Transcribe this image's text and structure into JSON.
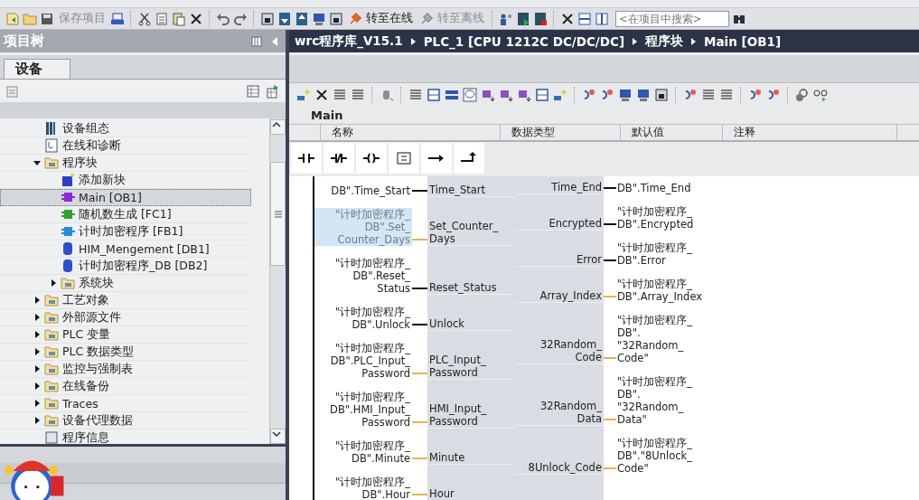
{
  "toolbar": {
    "items": [
      {
        "kind": "save",
        "label": "保存项目",
        "disabled": true
      },
      {
        "kind": "online",
        "label": "转至在线",
        "disabled": false
      },
      {
        "kind": "offline",
        "label": "转至离线",
        "disabled": true
      }
    ],
    "search": {
      "placeholder": "<在项目中搜索>"
    }
  },
  "project_tree": {
    "title": "项目树",
    "tabs": [
      {
        "label": "设备",
        "selected": true
      }
    ],
    "items": [
      {
        "label": "设备组态",
        "kind": "device",
        "selected": false
      },
      {
        "label": "在线和诊断",
        "kind": "diag",
        "selected": false
      },
      {
        "label": "程序块",
        "kind": "folder",
        "selected": false,
        "expanded": true,
        "children": [
          {
            "label": "添加新块",
            "kind": "add",
            "selected": false
          },
          {
            "label": "Main [OB1]",
            "kind": "ob",
            "selected": true
          },
          {
            "label": "随机数生成 [FC1]",
            "kind": "fc",
            "selected": false
          },
          {
            "label": "计时加密程序 [FB1]",
            "kind": "fb",
            "selected": false
          },
          {
            "label": "HIM_Mengement [DB1]",
            "kind": "db",
            "selected": false
          },
          {
            "label": "计时加密程序_DB [DB2]",
            "kind": "db",
            "selected": false
          },
          {
            "label": "系统块",
            "kind": "folder",
            "selected": false,
            "expanded": false
          }
        ]
      },
      {
        "label": "工艺对象",
        "kind": "folder",
        "selected": false,
        "expanded": false
      },
      {
        "label": "外部源文件",
        "kind": "folder",
        "selected": false,
        "expanded": false
      },
      {
        "label": "PLC 变量",
        "kind": "folder",
        "selected": false,
        "expanded": false
      },
      {
        "label": "PLC 数据类型",
        "kind": "folder",
        "selected": false,
        "expanded": false
      },
      {
        "label": "监控与强制表",
        "kind": "folder",
        "selected": false,
        "expanded": false
      },
      {
        "label": "在线备份",
        "kind": "folder",
        "selected": false,
        "expanded": false
      },
      {
        "label": "Traces",
        "kind": "folder",
        "selected": false,
        "expanded": false
      },
      {
        "label": "设备代理数据",
        "kind": "folder",
        "selected": false,
        "expanded": false
      },
      {
        "label": "程序信息",
        "kind": "info",
        "selected": false
      }
    ]
  },
  "editor": {
    "breadcrumb": [
      "wrc程序库_V15.1",
      "PLC_1 [CPU 1212C DC/DC/DC]",
      "程序块",
      "Main [OB1]"
    ],
    "block_title": "Main",
    "interface_columns": [
      "名称",
      "数据类型",
      "默认值",
      "注释"
    ],
    "block": {
      "inputs": [
        {
          "operand": "DB\".Time_Start",
          "pin": "Time_Start",
          "kind": "bool",
          "selected": false
        },
        {
          "operand": "\"计时加密程序_\nDB\".Set_\nCounter_Days",
          "pin": "Set_Counter_\nDays",
          "kind": "word",
          "selected": true
        },
        {
          "operand": "\"计时加密程序_\nDB\".Reset_\nStatus",
          "pin": "Reset_Status",
          "kind": "bool",
          "selected": false
        },
        {
          "operand": "\"计时加密程序_\nDB\".Unlock",
          "pin": "Unlock",
          "kind": "bool",
          "selected": false
        },
        {
          "operand": "\"计时加密程序_\nDB\".PLC_Input_\nPassword",
          "pin": "PLC_Input_\nPassword",
          "kind": "word",
          "selected": false
        },
        {
          "operand": "\"计时加密程序_\nDB\".HMI_Input_\nPassword",
          "pin": "HMI_Input_\nPassword",
          "kind": "word",
          "selected": false
        },
        {
          "operand": "\"计时加密程序_\nDB\".Minute",
          "pin": "Minute",
          "kind": "word",
          "selected": false
        },
        {
          "operand": "\"计时加密程序_\nDB\".Hour",
          "pin": "Hour",
          "kind": "word",
          "selected": false
        }
      ],
      "outputs": [
        {
          "pin": "Time_End",
          "operand": "DB\".Time_End",
          "kind": "bool"
        },
        {
          "pin": "Encrypted",
          "operand": "\"计时加密程序_\nDB\".Encrypted",
          "kind": "bool"
        },
        {
          "pin": "Error",
          "operand": "\"计时加密程序_\nDB\".Error",
          "kind": "bool"
        },
        {
          "pin": "Array_Index",
          "operand": "\"计时加密程序_\nDB\".Array_Index",
          "kind": "word"
        },
        {
          "pin": "32Random_\nCode",
          "operand": "\"计时加密程序_\nDB\".\n\"32Random_\nCode\"",
          "kind": "word"
        },
        {
          "pin": "32Random_\nData",
          "operand": "\"计时加密程序_\nDB\".\n\"32Random_\nData\"",
          "kind": "word"
        },
        {
          "pin": "8Unlock_Code",
          "operand": "\"计时加密程序_\nDB\".\"8Unlock_\nCode\"",
          "kind": "word"
        }
      ]
    }
  }
}
